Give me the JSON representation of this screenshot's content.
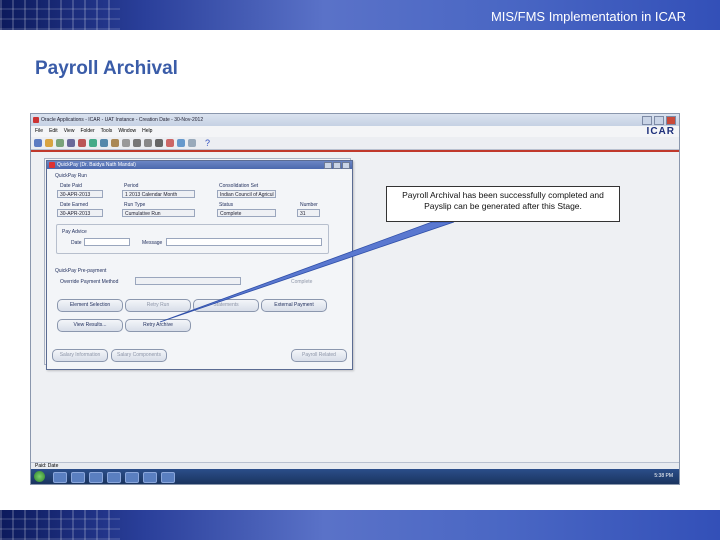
{
  "slide": {
    "header_title": "MIS/FMS Implementation in ICAR",
    "page_title": "Payroll Archival",
    "callout_text": "Payroll Archival has been successfully completed and Payslip can be generated after this Stage."
  },
  "app": {
    "window_title": "Oracle Applications - ICAR - UAT Instance - Creation Date - 30-Nov-2012",
    "menu": [
      "File",
      "Edit",
      "View",
      "Folder",
      "Tools",
      "Window",
      "Help"
    ],
    "brand": "ICAR",
    "help_glyph": "?",
    "status_text": "Paid: Date",
    "clock": "5:38 PM"
  },
  "form": {
    "title": "QuickPay (Dr. Baidya Nath Mandal)",
    "quickpay_run_label": "QuickPay Run",
    "date_paid_label": "Date Paid",
    "date_paid": "30-APR-2013",
    "period_label": "Period",
    "period": "1 2013 Calendar Month",
    "consolidation_label": "Consolidation Set",
    "consolidation": "Indian Council of Agricul",
    "date_earned_label": "Date Earned",
    "date_earned": "30-APR-2013",
    "run_type_label": "Run Type",
    "run_type": "Cumulative Run",
    "status_label": "Status",
    "status": "Complete",
    "number_label": "Number",
    "number": "31",
    "pay_advice_label": "Pay Advice",
    "date_label": "Date",
    "message_label": "Message",
    "prepayment_label": "QuickPay Pre-payment",
    "override_label": "Override Payment Method",
    "prepay_status": "Complete",
    "buttons": {
      "element_selection": "Element Selection",
      "retry_run": "Retry Run",
      "statements": "Statements",
      "external_payment": "External Payment",
      "view_results": "View Results...",
      "retry_archive": "Retry Archive"
    }
  },
  "background_window": {
    "salary_information": "Salary Information",
    "salary_components": "Salary Components",
    "payroll_related": "Payroll Related"
  }
}
